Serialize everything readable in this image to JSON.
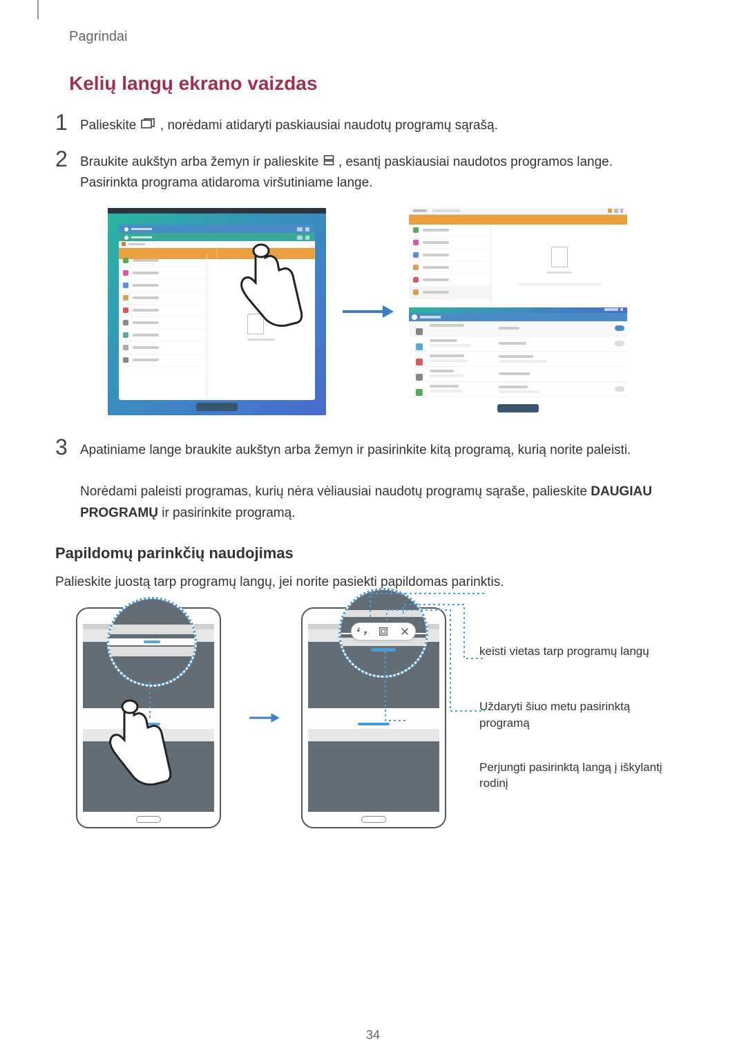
{
  "header": {
    "breadcrumb": "Pagrindai"
  },
  "section": {
    "title": "Kelių langų ekrano vaizdas"
  },
  "steps": {
    "step1": {
      "number": "1",
      "text_before": "Palieskite ",
      "text_after": ", norėdami atidaryti paskiausiai naudotų programų sąrašą."
    },
    "step2": {
      "number": "2",
      "line1_before": "Braukite aukštyn arba žemyn ir palieskite ",
      "line1_after": ", esantį paskiausiai naudotos programos lange.",
      "line2": "Pasirinkta programa atidaroma viršutiniame lange."
    },
    "step3": {
      "number": "3",
      "line1": "Apatiniame lange braukite aukštyn arba žemyn ir pasirinkite kitą programą, kurią norite paleisti.",
      "line2_before": "Norėdami paleisti programas, kurių nėra vėliausiai naudotų programų sąraše, palieskite ",
      "line2_bold": "DAUGIAU PROGRAMŲ",
      "line2_after": " ir pasirinkite programą."
    }
  },
  "subsection": {
    "heading": "Papildomų parinkčių naudojimas",
    "body": "Palieskite juostą tarp programų langų, jei norite pasiekti papildomas parinktis."
  },
  "callouts": {
    "swap": "keisti vietas tarp programų langų",
    "close": "Uždaryti šiuo metu pasirinktą programą",
    "popup": "Perjungti pasirinktą langą į iškylantį rodinį"
  },
  "page_number": "34",
  "icons": {
    "recent_apps": "recent-apps-icon",
    "split_view": "split-view-icon"
  }
}
